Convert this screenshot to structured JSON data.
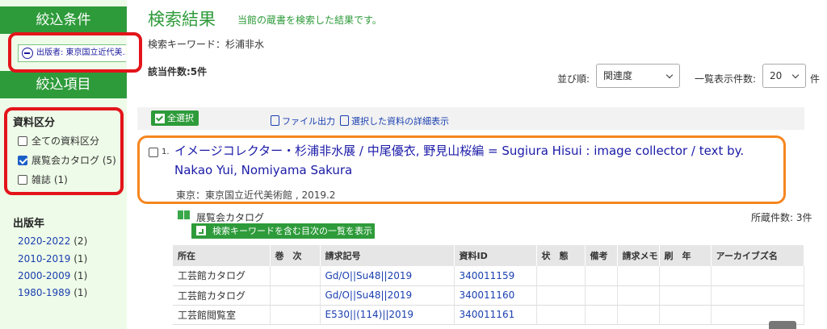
{
  "sidebar": {
    "filter_header": "絞込条件",
    "active_filter": "出版者: 東京国立近代美...",
    "refine_header": "絞込項目",
    "material_type": {
      "title": "資料区分",
      "items": [
        {
          "label": "全ての資料区分",
          "count": "",
          "checked": false
        },
        {
          "label": "展覧会カタログ",
          "count": "(5)",
          "checked": true
        },
        {
          "label": "雑誌",
          "count": "(1)",
          "checked": false
        }
      ]
    },
    "pub_year": {
      "title": "出版年",
      "items": [
        {
          "label": "2020-2022",
          "count": "(2)"
        },
        {
          "label": "2010-2019",
          "count": "(1)"
        },
        {
          "label": "2000-2009",
          "count": "(1)"
        },
        {
          "label": "1980-1989",
          "count": "(1)"
        }
      ]
    }
  },
  "main": {
    "title": "検索結果",
    "subtitle": "当館の蔵書を検索した結果です。",
    "keyword_line": "検索キーワード：杉浦非水",
    "hit_count": "該当件数:5件",
    "sort_label": "並び順:",
    "sort_value": "関連度",
    "per_page_label": "一覧表示件数:",
    "per_page_value": "20",
    "per_page_tail": "件"
  },
  "toolbar": {
    "select_all": "全選択",
    "file_output": "ファイル出力",
    "detail_view": "選択した資料の詳細表示"
  },
  "record": {
    "number": "1.",
    "title": "イメージコレクター・杉浦非水展 / 中尾優衣, 野見山桜編 = Sugiura Hisui : image collector / text by. Nakao Yui, Nomiyama Sakura",
    "publisher": "東京：東京国立近代美術館 , 2019.2",
    "type_label": "展覧会カタログ",
    "holdings_count": "所蔵件数: 3件",
    "toc_button": "検索キーワードを含む目次の一覧を表示"
  },
  "holdings_table": {
    "headers": [
      "所在",
      "巻　次",
      "請求記号",
      "資料ID",
      "状　態",
      "備考",
      "請求メモ",
      "刷　年",
      "アーカイブズ名"
    ],
    "rows": [
      [
        "工芸館カタログ",
        "",
        "Gd/O||Su48||2019",
        "340011159",
        "",
        "",
        "",
        "",
        ""
      ],
      [
        "工芸館カタログ",
        "",
        "Gd/O||Su48||2019",
        "340011160",
        "",
        "",
        "",
        "",
        ""
      ],
      [
        "工芸館閲覧室",
        "",
        "E530||(114)||2019",
        "340011161",
        "",
        "",
        "",
        "",
        ""
      ]
    ]
  },
  "colors": {
    "accent_green": "#2e9b3a",
    "highlight_red": "#e3141b",
    "highlight_orange": "#f5861f",
    "link_blue": "#1a3fb0"
  }
}
